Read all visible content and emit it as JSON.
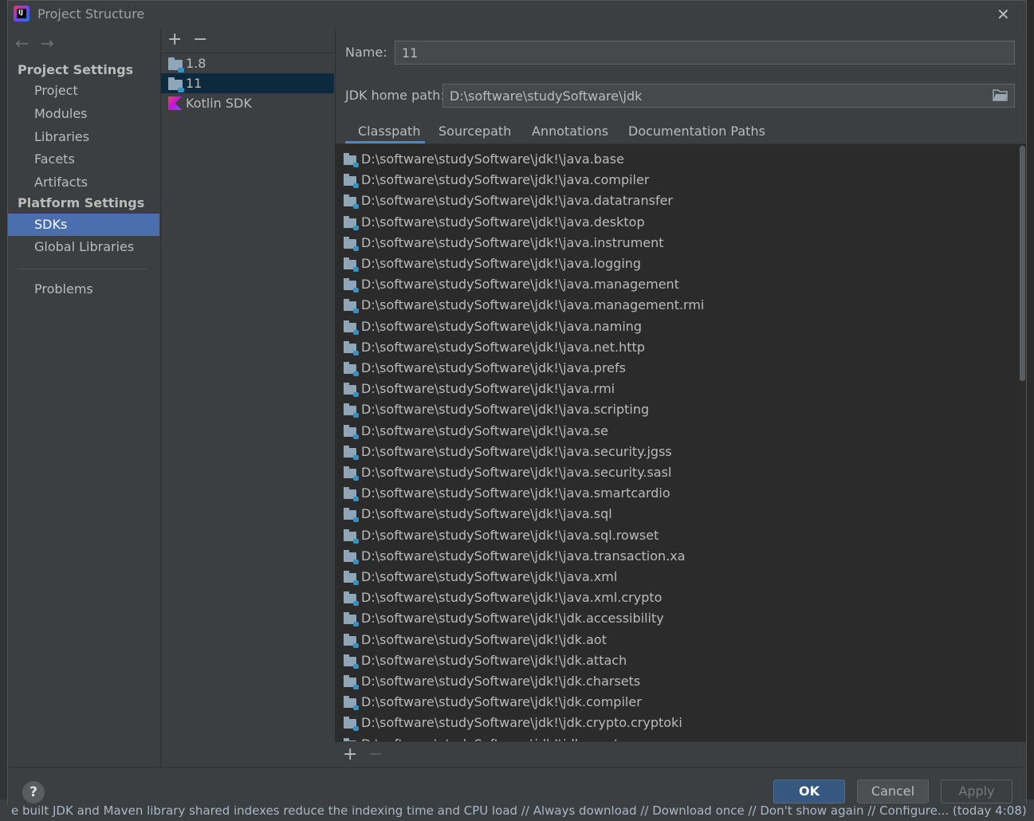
{
  "background": {
    "status_text": "e built JDK and Maven library shared indexes reduce the indexing time and CPU load // Always download // Download once // Don't show again // Configure... (today 4:08)"
  },
  "window": {
    "title": "Project Structure"
  },
  "sidebar": {
    "project_settings_header": "Project Settings",
    "project_items": [
      "Project",
      "Modules",
      "Libraries",
      "Facets",
      "Artifacts"
    ],
    "platform_settings_header": "Platform Settings",
    "platform_items": [
      "SDKs",
      "Global Libraries"
    ],
    "selected": "SDKs",
    "problems": "Problems"
  },
  "sdk_list": {
    "items": [
      {
        "label": "1.8",
        "icon": "jdk-folder-icon",
        "selected": false
      },
      {
        "label": "11",
        "icon": "jdk-folder-icon",
        "selected": true
      },
      {
        "label": "Kotlin SDK",
        "icon": "kotlin-icon",
        "selected": false
      }
    ]
  },
  "details": {
    "name_label": "Name:",
    "name_value": "11",
    "jdk_home_label": "JDK home path:",
    "jdk_home_value": "D:\\software\\studySoftware\\jdk",
    "tabs": [
      "Classpath",
      "Sourcepath",
      "Annotations",
      "Documentation Paths"
    ],
    "active_tab": "Classpath",
    "classpath": [
      "D:\\software\\studySoftware\\jdk!\\java.base",
      "D:\\software\\studySoftware\\jdk!\\java.compiler",
      "D:\\software\\studySoftware\\jdk!\\java.datatransfer",
      "D:\\software\\studySoftware\\jdk!\\java.desktop",
      "D:\\software\\studySoftware\\jdk!\\java.instrument",
      "D:\\software\\studySoftware\\jdk!\\java.logging",
      "D:\\software\\studySoftware\\jdk!\\java.management",
      "D:\\software\\studySoftware\\jdk!\\java.management.rmi",
      "D:\\software\\studySoftware\\jdk!\\java.naming",
      "D:\\software\\studySoftware\\jdk!\\java.net.http",
      "D:\\software\\studySoftware\\jdk!\\java.prefs",
      "D:\\software\\studySoftware\\jdk!\\java.rmi",
      "D:\\software\\studySoftware\\jdk!\\java.scripting",
      "D:\\software\\studySoftware\\jdk!\\java.se",
      "D:\\software\\studySoftware\\jdk!\\java.security.jgss",
      "D:\\software\\studySoftware\\jdk!\\java.security.sasl",
      "D:\\software\\studySoftware\\jdk!\\java.smartcardio",
      "D:\\software\\studySoftware\\jdk!\\java.sql",
      "D:\\software\\studySoftware\\jdk!\\java.sql.rowset",
      "D:\\software\\studySoftware\\jdk!\\java.transaction.xa",
      "D:\\software\\studySoftware\\jdk!\\java.xml",
      "D:\\software\\studySoftware\\jdk!\\java.xml.crypto",
      "D:\\software\\studySoftware\\jdk!\\jdk.accessibility",
      "D:\\software\\studySoftware\\jdk!\\jdk.aot",
      "D:\\software\\studySoftware\\jdk!\\jdk.attach",
      "D:\\software\\studySoftware\\jdk!\\jdk.charsets",
      "D:\\software\\studySoftware\\jdk!\\jdk.compiler",
      "D:\\software\\studySoftware\\jdk!\\jdk.crypto.cryptoki",
      "D:\\software\\studySoftware\\jdk!\\jdk.crypto.ec"
    ]
  },
  "footer": {
    "help": "?",
    "ok": "OK",
    "cancel": "Cancel",
    "apply": "Apply"
  },
  "toolbar": {
    "add": "+",
    "remove": "−",
    "back": "←",
    "forward": "→",
    "close": "✕"
  }
}
